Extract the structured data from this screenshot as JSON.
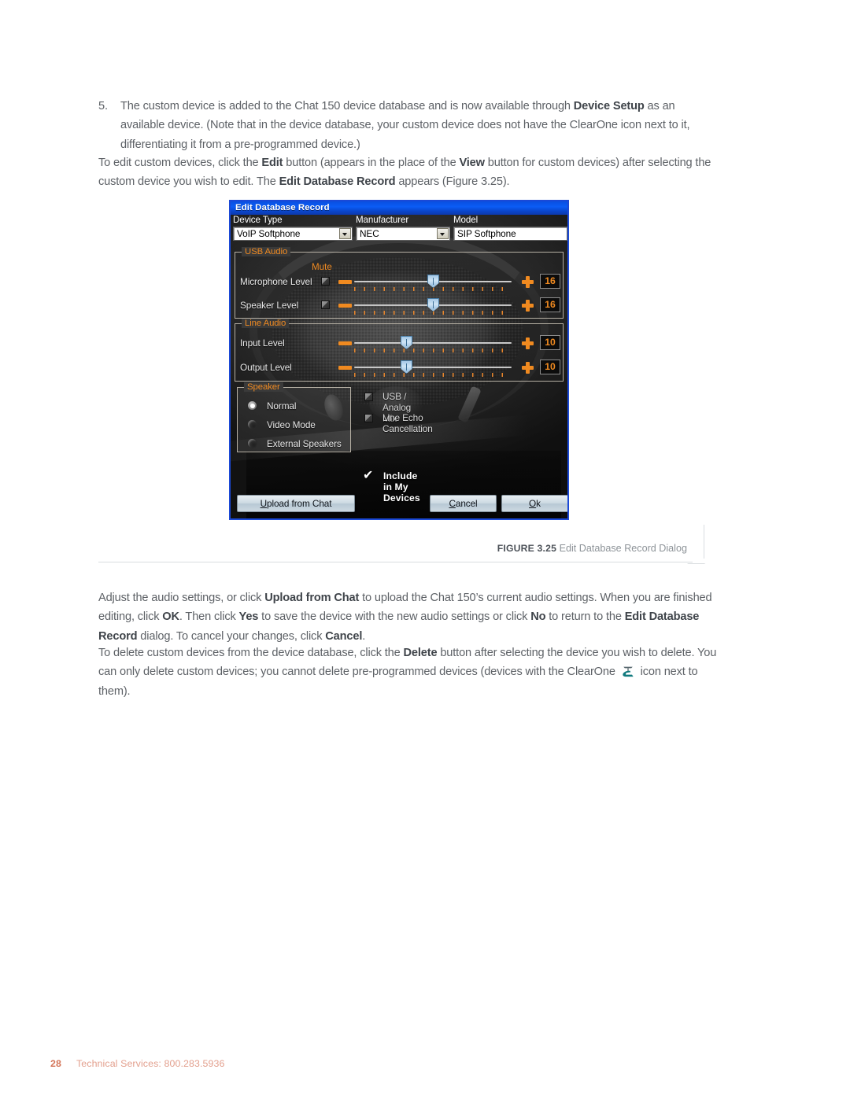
{
  "page": {
    "step_number": "5.",
    "step_text_html": "The custom device is added to the Chat 150 device database and is now available through <b>Device Setup</b> as an available device. (Note that in the device database, your custom device does not have the ClearOne icon next to it, differentiating it from a pre-programmed device.)",
    "para2_html": "To edit custom devices, click the <b>Edit</b> button (appears in the place of the <b>View</b> button for custom devices) after selecting the custom device you wish to edit. The <b>Edit Database Record</b> appears (Figure 3.25).",
    "para3_html": "Adjust the audio settings, or click <b>Upload from Chat</b> to upload the Chat 150’s current audio settings. When you are finished editing, click <b>OK</b>. Then click <b>Yes</b> to save the device with the new audio settings or click <b>No</b> to return to the <b>Edit Database Record</b> dialog. To cancel your changes, click <b>Cancel</b>.",
    "para4_html": "To delete custom devices from the device database, click the <b>Delete</b> button after selecting the device you wish to delete. You can only delete custom devices; you cannot delete pre-programmed devices (devices with the ClearOne <span class=\"clearone-glyph\" data-name=\"clearone-logo-icon\"><svg viewBox=\"0 0 24 20\" width=\"20\" height=\"17\"><path d=\"M5 3 H19 L17 5 H7 Z\" fill=\"#5a6a70\"/><path d=\"M12 5 L12 10\" stroke=\"#5a6a70\" stroke-width=\"1.6\" fill=\"none\"/><path d=\"M15 9 C8 9 4 12 4 15 C4 17 6 18 9 18 L20 18 L18 15 L9 15 C8 15 8 13 10 12 L16 11 Z\" fill=\"#117a7e\"/></svg></span> icon next to them).",
    "figure": {
      "label": "FIGURE 3.25",
      "caption": "Edit Database Record Dialog"
    },
    "footer": {
      "page_number": "28",
      "text": "Technical Services: 800.283.5936"
    }
  },
  "dialog": {
    "title": "Edit Database Record",
    "fields": {
      "device_type": {
        "label": "Device Type",
        "value": "VoIP  Softphone",
        "type": "combobox"
      },
      "manufacturer": {
        "label": "Manufacturer",
        "value": "NEC",
        "type": "combobox"
      },
      "model": {
        "label": "Model",
        "value": "SIP Softphone",
        "type": "textbox"
      }
    },
    "usb_audio": {
      "group_label": "USB Audio",
      "mute_label": "Mute",
      "rows": [
        {
          "label": "Microphone Level",
          "value": "16",
          "position_pct": 50,
          "muted": false
        },
        {
          "label": "Speaker Level",
          "value": "16",
          "position_pct": 50,
          "muted": false
        }
      ]
    },
    "line_audio": {
      "group_label": "Line Audio",
      "rows": [
        {
          "label": "Input Level",
          "value": "10",
          "position_pct": 33,
          "muted": false
        },
        {
          "label": "Output Level",
          "value": "10",
          "position_pct": 33,
          "muted": false
        }
      ]
    },
    "speaker": {
      "group_label": "Speaker",
      "options": [
        {
          "label": "Normal",
          "selected": true
        },
        {
          "label": "Video Mode",
          "selected": false
        },
        {
          "label": "External Speakers",
          "selected": false
        }
      ]
    },
    "checkboxes": [
      {
        "label": "USB / Analog Mix",
        "checked": false
      },
      {
        "label": "Line Echo Cancellation",
        "checked": false
      }
    ],
    "include_in_my_devices": {
      "label": "Include in My Devices",
      "checked": true,
      "check_glyph": "✔"
    },
    "buttons": {
      "upload": {
        "label_html": "<u>U</u>pload from Chat"
      },
      "cancel": {
        "label_html": "<u>C</u>ancel"
      },
      "ok": {
        "label_html": "<u>O</u>k"
      }
    }
  },
  "colors": {
    "title_blue": "#0b5cf5",
    "dialog_border": "#1b49d6",
    "accent_orange": "#ef8a22",
    "group_border": "#b6b0a4",
    "lcd_text": "#f08a20",
    "body_text": "#5d6166",
    "footer_orange": "#d4765a"
  }
}
